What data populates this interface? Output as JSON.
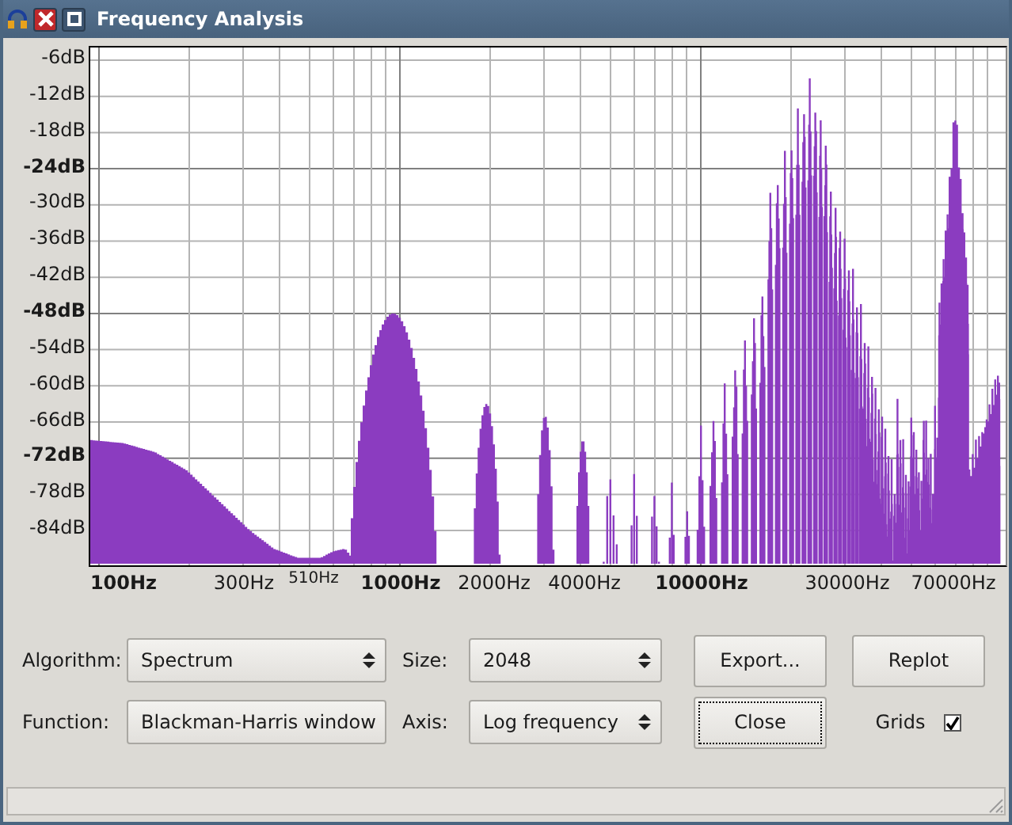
{
  "window": {
    "title": "Frequency Analysis"
  },
  "plot": {
    "y_labels": [
      {
        "text": "-6dB",
        "major": false
      },
      {
        "text": "-12dB",
        "major": false
      },
      {
        "text": "-18dB",
        "major": false
      },
      {
        "text": "-24dB",
        "major": true
      },
      {
        "text": "-30dB",
        "major": false
      },
      {
        "text": "-36dB",
        "major": false
      },
      {
        "text": "-42dB",
        "major": false
      },
      {
        "text": "-48dB",
        "major": true
      },
      {
        "text": "-54dB",
        "major": false
      },
      {
        "text": "-60dB",
        "major": false
      },
      {
        "text": "-66dB",
        "major": false
      },
      {
        "text": "-72dB",
        "major": true
      },
      {
        "text": "-78dB",
        "major": false
      },
      {
        "text": "-84dB",
        "major": false
      }
    ],
    "x_labels": [
      {
        "text": "100Hz",
        "kind": "major"
      },
      {
        "text": "300Hz",
        "kind": "minor"
      },
      {
        "text": "510Hz",
        "kind": "cursor"
      },
      {
        "text": "1000Hz",
        "kind": "major"
      },
      {
        "text": "2000Hz",
        "kind": "minor"
      },
      {
        "text": "4000Hz",
        "kind": "minor"
      },
      {
        "text": "10000Hz",
        "kind": "major"
      },
      {
        "text": "30000Hz",
        "kind": "minor"
      },
      {
        "text": "70000Hz",
        "kind": "minor"
      }
    ]
  },
  "controls": {
    "algorithm": {
      "label": "Algorithm:",
      "value": "Spectrum"
    },
    "size": {
      "label": "Size:",
      "value": "2048"
    },
    "function": {
      "label": "Function:",
      "value": "Blackman-Harris window"
    },
    "axis": {
      "label": "Axis:",
      "value": "Log frequency"
    },
    "buttons": [
      {
        "label": "Export...",
        "focused": false
      },
      {
        "label": "Replot",
        "focused": false
      },
      {
        "label": "Close",
        "focused": true
      }
    ],
    "grids": {
      "label": "Grids",
      "checked": true
    }
  }
}
